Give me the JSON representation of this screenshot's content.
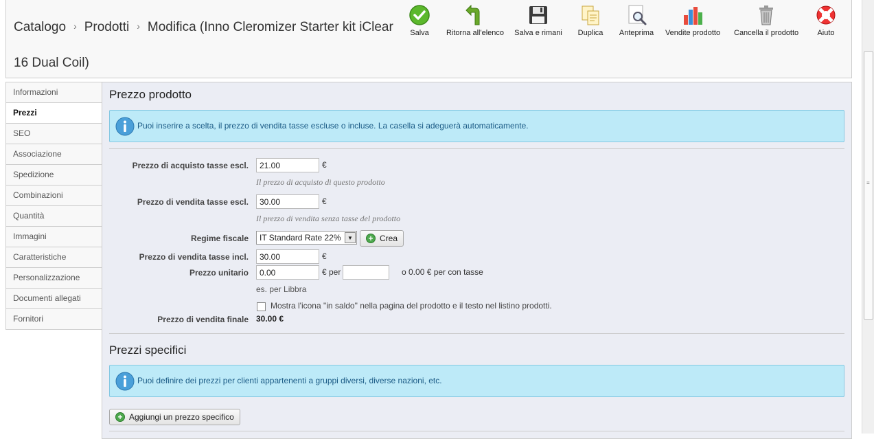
{
  "breadcrumb": {
    "items": [
      "Catalogo",
      "Prodotti",
      "Modifica (Inno Cleromizer Starter kit iClear 16 Dual Coil)"
    ],
    "separator": "›"
  },
  "toolbar": {
    "save": "Salva",
    "back": "Ritorna all'elenco",
    "save_stay": "Salva e rimani",
    "duplicate": "Duplica",
    "preview": "Anteprima",
    "sales": "Vendite prodotto",
    "delete": "Cancella il prodotto",
    "help": "Aiuto"
  },
  "sidebar": {
    "items": [
      {
        "label": "Informazioni"
      },
      {
        "label": "Prezzi",
        "active": true
      },
      {
        "label": "SEO"
      },
      {
        "label": "Associazione"
      },
      {
        "label": "Spedizione"
      },
      {
        "label": "Combinazioni"
      },
      {
        "label": "Quantità"
      },
      {
        "label": "Immagini"
      },
      {
        "label": "Caratteristiche"
      },
      {
        "label": "Personalizzazione"
      },
      {
        "label": "Documenti allegati"
      },
      {
        "label": "Fornitori"
      }
    ]
  },
  "pricing": {
    "title": "Prezzo prodotto",
    "info": "Puoi inserire a scelta, il prezzo di vendita tasse escluse o incluse. La casella si adeguerà automaticamente.",
    "wholesale_label": "Prezzo di acquisto tasse escl.",
    "wholesale_value": "21.00",
    "wholesale_hint": "Il prezzo di acquisto di questo prodotto",
    "retail_label": "Prezzo di vendita tasse escl.",
    "retail_value": "30.00",
    "retail_hint": "Il prezzo di vendita senza tasse del prodotto",
    "tax_label": "Regime fiscale",
    "tax_value": "IT Standard Rate 22%",
    "create_label": "Crea",
    "retail_incl_label": "Prezzo di vendita tasse incl.",
    "retail_incl_value": "30.00",
    "unit_label": "Prezzo unitario",
    "unit_value": "0.00",
    "unit_per": "€ per",
    "unit_per_value": "",
    "unit_with_tax": "o 0.00 € per con tasse",
    "unit_example": "es. per Libbra",
    "on_sale_label": "Mostra l'icona \"in saldo\" nella pagina del prodotto e il testo nel listino prodotti.",
    "final_label": "Prezzo di vendita finale",
    "final_value": "30.00 €",
    "currency": "€"
  },
  "specific": {
    "title": "Prezzi specifici",
    "info": "Puoi definire dei prezzi per clienti appartenenti a gruppi diversi, diverse nazioni, etc.",
    "add_label": "Aggiungi un prezzo specifico"
  },
  "colors": {
    "info_bg": "#bdeaf8",
    "info_text": "#1a5a85",
    "panel_bg": "#ebedf4"
  }
}
